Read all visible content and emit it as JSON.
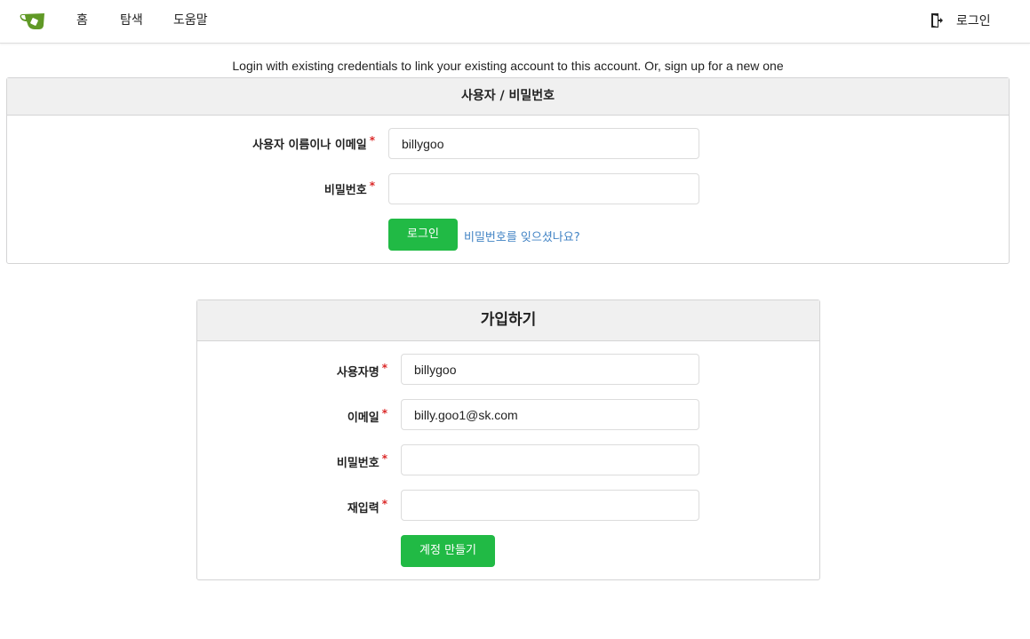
{
  "nav": {
    "logo": "gitea-logo",
    "home": "홈",
    "explore": "탐색",
    "help": "도움말",
    "login": "로그인",
    "login_icon": "sign-in-icon"
  },
  "notice": "Login with existing credentials to link your existing account to this account. Or, sign up for a new one",
  "signin": {
    "header": "사용자 / 비밀번호",
    "username_label": "사용자 이름이나 이메일",
    "username_value": "billygoo",
    "password_label": "비밀번호",
    "password_value": "",
    "required_mark": "*",
    "submit_label": "로그인",
    "forgot_label": "비밀번호를 잊으셨나요?"
  },
  "signup": {
    "header": "가입하기",
    "username_label": "사용자명",
    "username_value": "billygoo",
    "email_label": "이메일",
    "email_value": "billy.goo1@sk.com",
    "password_label": "비밀번호",
    "password_value": "",
    "retype_label": "재입력",
    "retype_value": "",
    "required_mark": "*",
    "submit_label": "계정 만들기"
  },
  "colors": {
    "primary_green": "#21ba45",
    "link_blue": "#4183c4",
    "required_red": "#db2828",
    "logo_green": "#609926"
  }
}
